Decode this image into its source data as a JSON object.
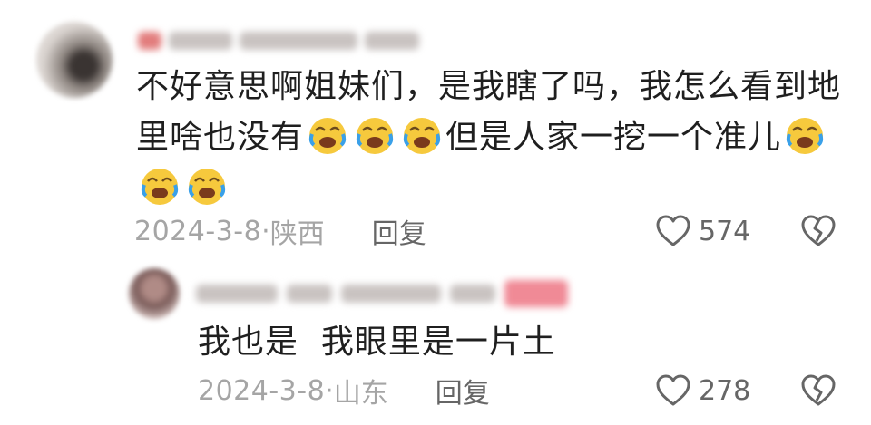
{
  "comment": {
    "text_line1": "不好意思啊姐妹们，是我瞎了吗，我怎么看到地",
    "text_line2_a": "里啥也没有",
    "text_line2_b": "但是人家一挖一个准儿",
    "emoji_icon": "crying-laughing-emoji-icon",
    "date": "2024-3-8",
    "location": "陕西",
    "reply_label": "回复",
    "likes": "574"
  },
  "reply": {
    "text": "我也是  我眼里是一片土",
    "date": "2024-3-8",
    "location": "山东",
    "reply_label": "回复",
    "likes": "278"
  },
  "colors": {
    "text": "#1f1f1f",
    "meta": "#a5a5a5",
    "action": "#666666",
    "badge": "#f08a96"
  }
}
